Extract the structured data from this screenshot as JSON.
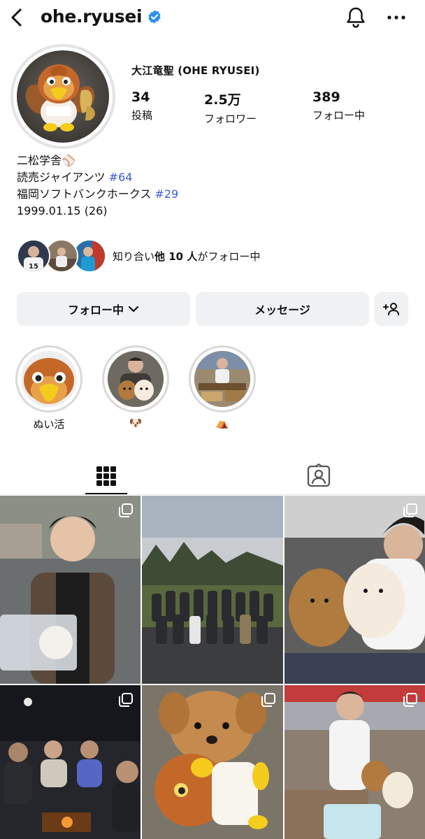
{
  "header": {
    "username": "ohe.ryusei",
    "back_icon": "chevron-left-icon",
    "verified_icon": "verified-badge-icon",
    "bell_icon": "bell-icon",
    "more_icon": "more-horizontal-icon"
  },
  "profile": {
    "display_name": "大江竜聖 (OHE RYUSEI)",
    "stats": {
      "posts_count": "34",
      "posts_label": "投稿",
      "followers_count": "2.5万",
      "followers_label": "フォロワー",
      "following_count": "389",
      "following_label": "フォロー中"
    },
    "bio": {
      "line1": "二松学舎⚾",
      "line2_text": "読売ジャイアンツ ",
      "line2_tag": "#64",
      "line3_text": "福岡ソフトバンクホークス ",
      "line3_tag": "#29",
      "line4": "1999.01.15 (26)"
    },
    "mutuals": {
      "prefix": "知り合い",
      "bold": "他 10 人",
      "suffix": "がフォロー中"
    }
  },
  "actions": {
    "follow_label": "フォロー中",
    "message_label": "メッセージ",
    "add_user_icon": "add-person-icon"
  },
  "highlights": [
    {
      "label": "ぬい活"
    },
    {
      "label": "🐶"
    },
    {
      "label": "⛺"
    }
  ],
  "tabs": {
    "grid_icon": "grid-icon",
    "tagged_icon": "tagged-person-icon"
  },
  "theme": {
    "accent": "#3c5bd8",
    "verified": "#2d8ef0",
    "button_bg": "#eff1f3"
  }
}
